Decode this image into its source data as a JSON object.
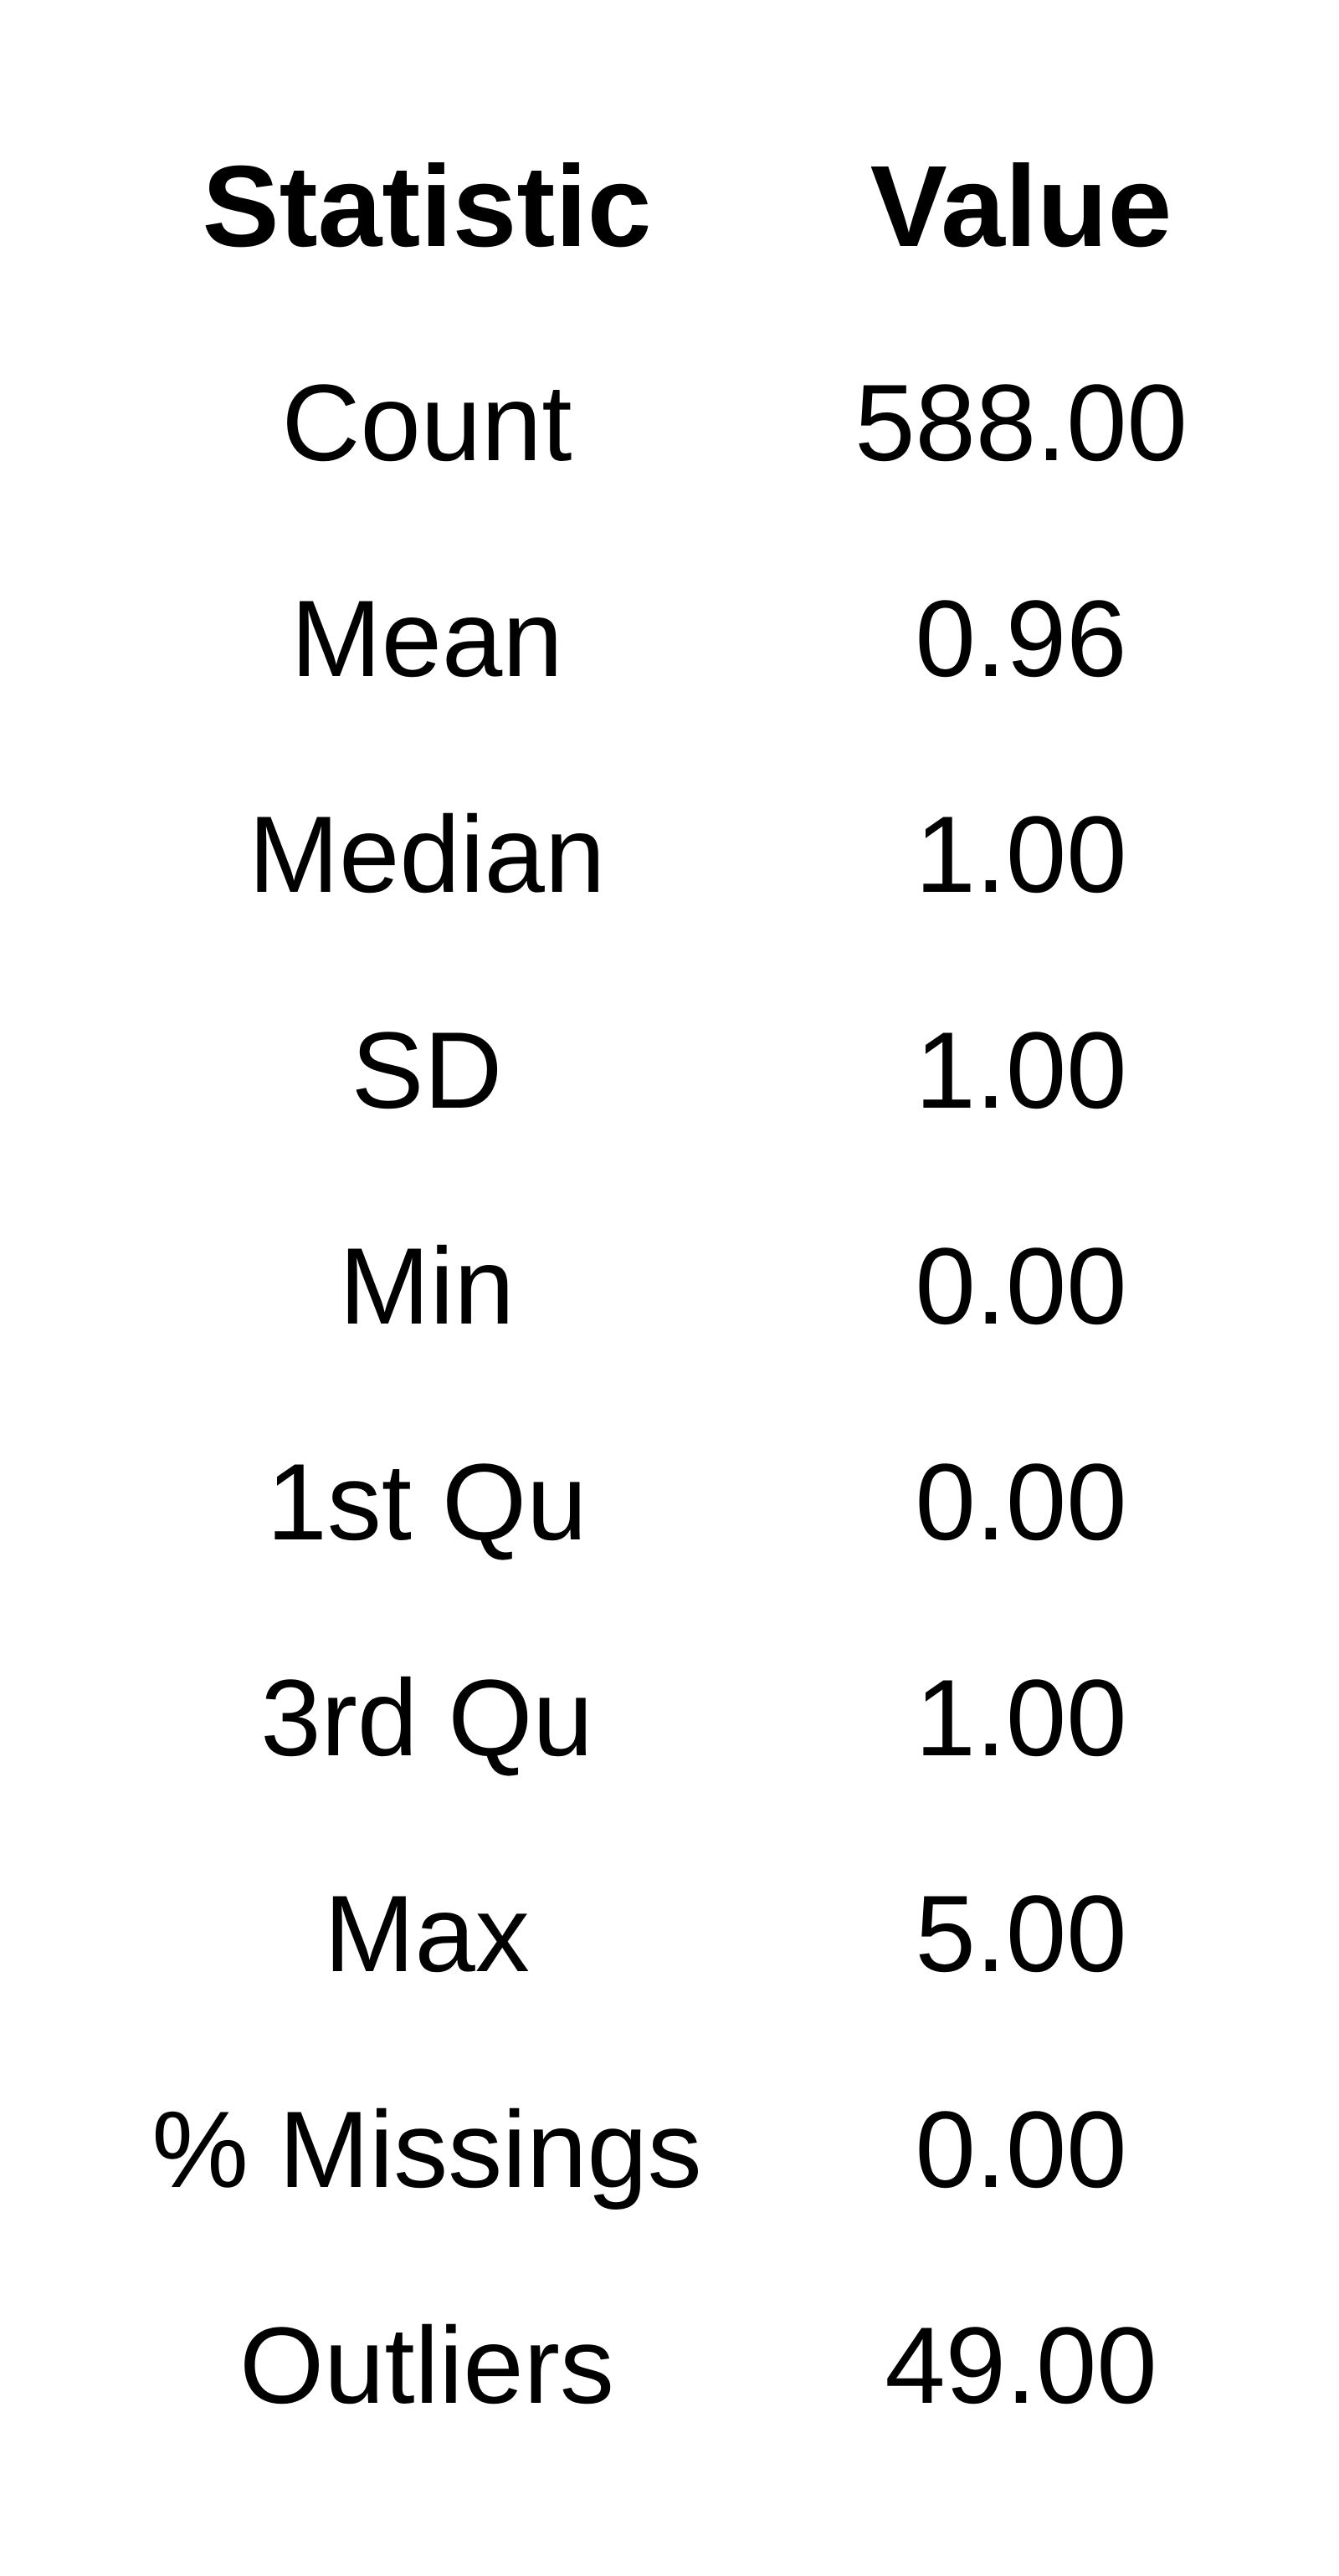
{
  "chart_data": {
    "type": "table",
    "columns": [
      "Statistic",
      "Value"
    ],
    "rows": [
      {
        "statistic": "Count",
        "value": "588.00"
      },
      {
        "statistic": "Mean",
        "value": "0.96"
      },
      {
        "statistic": "Median",
        "value": "1.00"
      },
      {
        "statistic": "SD",
        "value": "1.00"
      },
      {
        "statistic": "Min",
        "value": "0.00"
      },
      {
        "statistic": "1st Qu",
        "value": "0.00"
      },
      {
        "statistic": "3rd Qu",
        "value": "1.00"
      },
      {
        "statistic": "Max",
        "value": "5.00"
      },
      {
        "statistic": "% Missings",
        "value": "0.00"
      },
      {
        "statistic": "Outliers",
        "value": "49.00"
      }
    ]
  }
}
